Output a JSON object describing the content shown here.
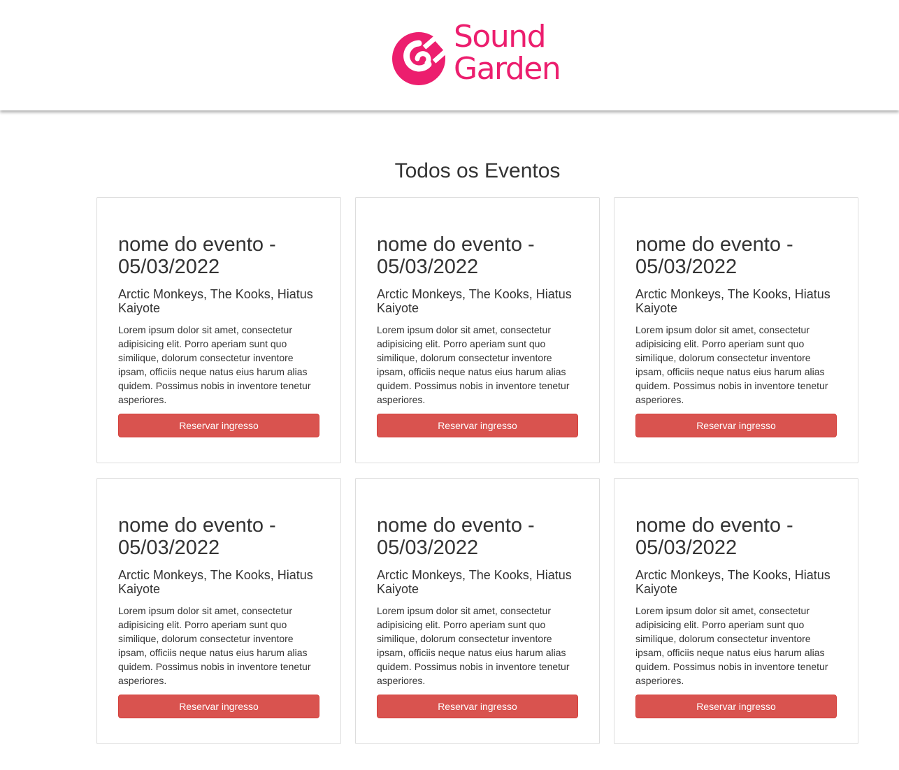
{
  "brand": {
    "name_line1": "Sound",
    "name_line2": "Garden",
    "color": "#ec1e6e"
  },
  "main": {
    "title": "Todos os Eventos"
  },
  "events": [
    {
      "title": "nome do evento - 05/03/2022",
      "artists": "Arctic Monkeys, The Kooks, Hiatus Kaiyote",
      "description": "Lorem ipsum dolor sit amet, consectetur adipisicing elit. Porro aperiam sunt quo similique, dolorum consectetur inventore ipsam, officiis neque natus eius harum alias quidem. Possimus nobis in inventore tenetur asperiores.",
      "button_label": "Reservar ingresso"
    },
    {
      "title": "nome do evento - 05/03/2022",
      "artists": "Arctic Monkeys, The Kooks, Hiatus Kaiyote",
      "description": "Lorem ipsum dolor sit amet, consectetur adipisicing elit. Porro aperiam sunt quo similique, dolorum consectetur inventore ipsam, officiis neque natus eius harum alias quidem. Possimus nobis in inventore tenetur asperiores.",
      "button_label": "Reservar ingresso"
    },
    {
      "title": "nome do evento - 05/03/2022",
      "artists": "Arctic Monkeys, The Kooks, Hiatus Kaiyote",
      "description": "Lorem ipsum dolor sit amet, consectetur adipisicing elit. Porro aperiam sunt quo similique, dolorum consectetur inventore ipsam, officiis neque natus eius harum alias quidem. Possimus nobis in inventore tenetur asperiores.",
      "button_label": "Reservar ingresso"
    },
    {
      "title": "nome do evento - 05/03/2022",
      "artists": "Arctic Monkeys, The Kooks, Hiatus Kaiyote",
      "description": "Lorem ipsum dolor sit amet, consectetur adipisicing elit. Porro aperiam sunt quo similique, dolorum consectetur inventore ipsam, officiis neque natus eius harum alias quidem. Possimus nobis in inventore tenetur asperiores.",
      "button_label": "Reservar ingresso"
    },
    {
      "title": "nome do evento - 05/03/2022",
      "artists": "Arctic Monkeys, The Kooks, Hiatus Kaiyote",
      "description": "Lorem ipsum dolor sit amet, consectetur adipisicing elit. Porro aperiam sunt quo similique, dolorum consectetur inventore ipsam, officiis neque natus eius harum alias quidem. Possimus nobis in inventore tenetur asperiores.",
      "button_label": "Reservar ingresso"
    },
    {
      "title": "nome do evento - 05/03/2022",
      "artists": "Arctic Monkeys, The Kooks, Hiatus Kaiyote",
      "description": "Lorem ipsum dolor sit amet, consectetur adipisicing elit. Porro aperiam sunt quo similique, dolorum consectetur inventore ipsam, officiis neque natus eius harum alias quidem. Possimus nobis in inventore tenetur asperiores.",
      "button_label": "Reservar ingresso"
    }
  ],
  "colors": {
    "button": "#d9534f",
    "text": "#333333"
  }
}
